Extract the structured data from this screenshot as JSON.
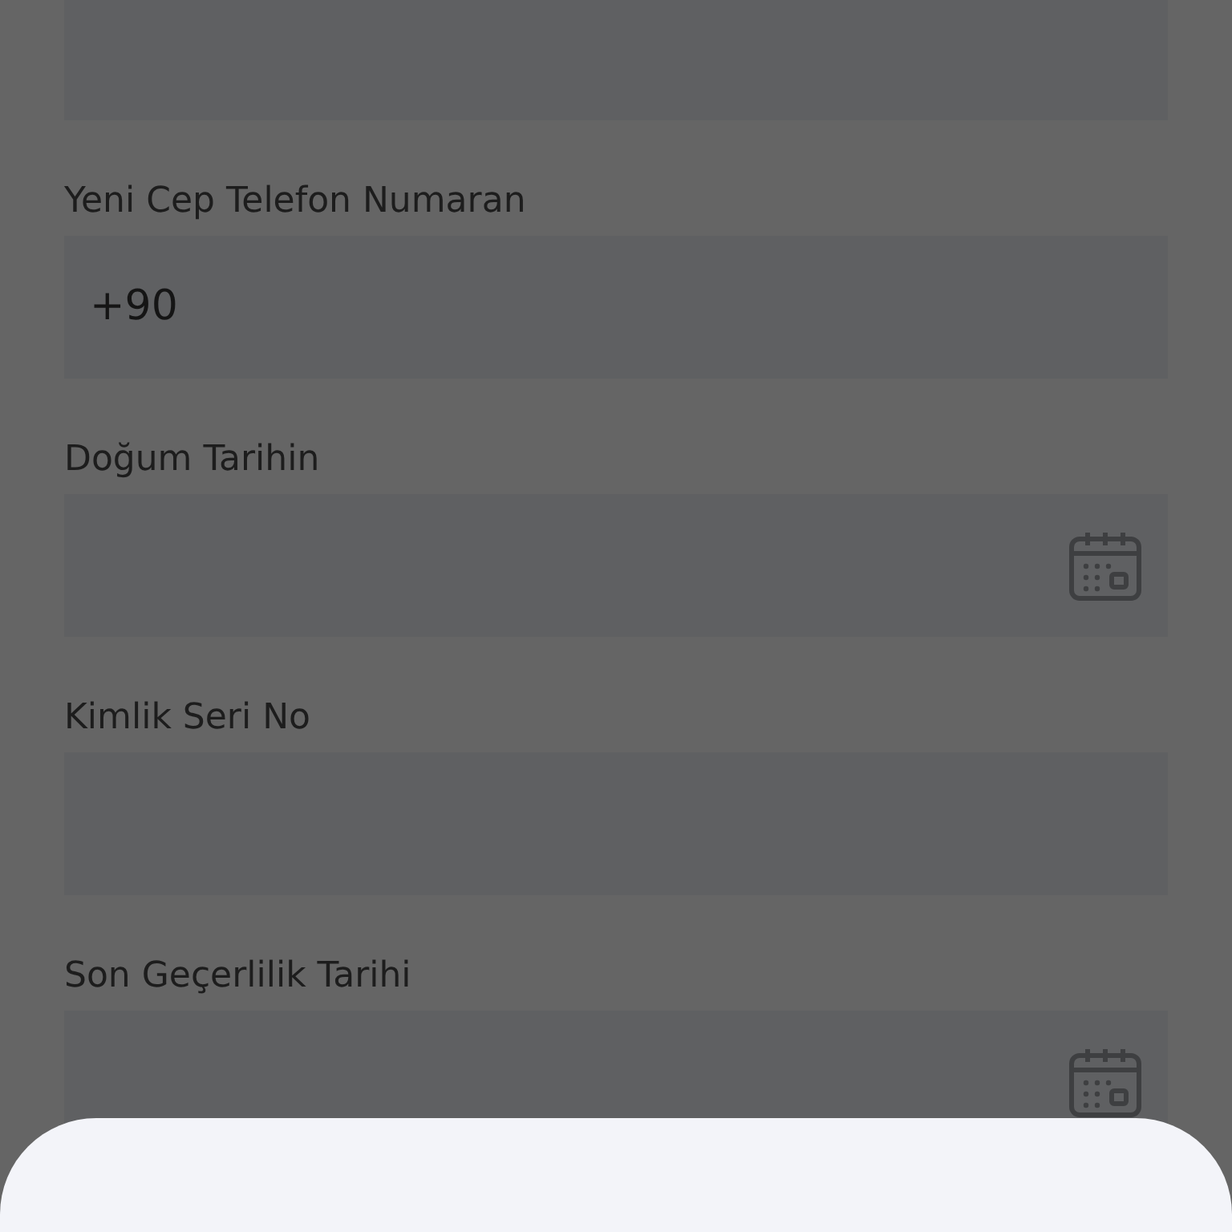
{
  "fields": [
    {
      "kind": "text"
    },
    {
      "kind": "text",
      "label": "Yeni Cep Telefon Numaran",
      "value": "+90"
    },
    {
      "kind": "date",
      "label": "Doğum Tarihin"
    },
    {
      "kind": "text",
      "label": "Kimlik Seri No"
    },
    {
      "kind": "date",
      "label": "Son Geçerlilik Tarihi"
    }
  ],
  "bottom_sheet": {
    "open": true
  }
}
